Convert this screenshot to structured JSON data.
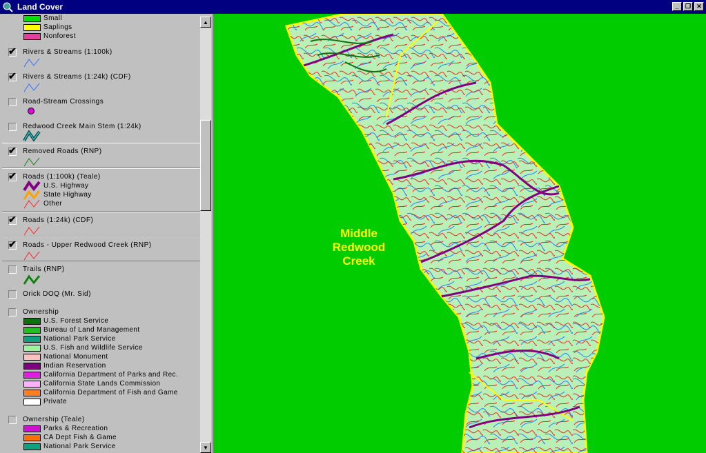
{
  "window": {
    "title": "Land Cover",
    "title_color": "#000080",
    "buttons": [
      "minimize",
      "restore",
      "close"
    ]
  },
  "legend": {
    "top_swatches": [
      {
        "label": "Small",
        "color": "#00e000"
      },
      {
        "label": "Saplings",
        "color": "#ffff00"
      },
      {
        "label": "Nonforest",
        "color": "#e040a0"
      }
    ],
    "layers": [
      {
        "name": "Rivers & Streams (1:100k)",
        "checked": true,
        "symbol": "blue-line"
      },
      {
        "name": "Rivers & Streams (1:24k) (CDF)",
        "checked": true,
        "symbol": "blue-line"
      },
      {
        "name": "Road-Stream Crossings",
        "checked": false,
        "symbol": "magenta-dot"
      },
      {
        "name": "Redwood Creek Main Stem (1:24k)",
        "checked": false,
        "symbol": "teal-line"
      },
      {
        "name": "Removed Roads (RNP)",
        "checked": true,
        "symbol": "green-line"
      },
      {
        "name": "Roads (1:100k) (Teale)",
        "checked": true,
        "symbol": "roads"
      },
      {
        "name": "Roads (1:24k) (CDF)",
        "checked": true,
        "symbol": "red-line"
      },
      {
        "name": "Roads - Upper Redwood Creek (RNP)",
        "checked": true,
        "symbol": "red-line"
      },
      {
        "name": "Trails (RNP)",
        "checked": false,
        "symbol": "dkgreen-line"
      },
      {
        "name": "Orick DOQ (Mr. Sid)",
        "checked": false,
        "symbol": "none"
      },
      {
        "name": "Ownership",
        "checked": false,
        "symbol": "none"
      },
      {
        "name": "Ownership (Teale)",
        "checked": false,
        "symbol": "none"
      }
    ],
    "roads_classes": [
      {
        "label": "U.S. Highway",
        "color": "#800080"
      },
      {
        "label": "State Highway",
        "color": "#ffa000"
      },
      {
        "label": "Other",
        "color": "#ff2020"
      }
    ],
    "ownership": [
      {
        "label": "U.S. Forest Service",
        "color": "#107010"
      },
      {
        "label": "Bureau of Land Management",
        "color": "#20c020"
      },
      {
        "label": "National Park Service",
        "color": "#10a080"
      },
      {
        "label": "U.S. Fish and Wildlife Service",
        "color": "#a0f0a0"
      },
      {
        "label": "National Monument",
        "color": "#ffc0c0"
      },
      {
        "label": "Indian Reservation",
        "color": "#800080"
      },
      {
        "label": "California Department of Parks and Rec.",
        "color": "#e020e0"
      },
      {
        "label": "California State Lands Commission",
        "color": "#ffb0ff"
      },
      {
        "label": "California Department of Fish and Game",
        "color": "#ff8020"
      },
      {
        "label": "Private",
        "color": "#ffffff"
      }
    ],
    "ownership_teale": [
      {
        "label": "Parks & Recreation",
        "color": "#d010d0"
      },
      {
        "label": "CA Dept Fish & Game",
        "color": "#ff7000"
      },
      {
        "label": "National Park Service",
        "color": "#10a080"
      }
    ]
  },
  "map": {
    "label_line1": "Middle",
    "label_line2": "Redwood",
    "label_line3": "Creek",
    "background_color": "#00cc00",
    "label_color": "#ffff00"
  }
}
